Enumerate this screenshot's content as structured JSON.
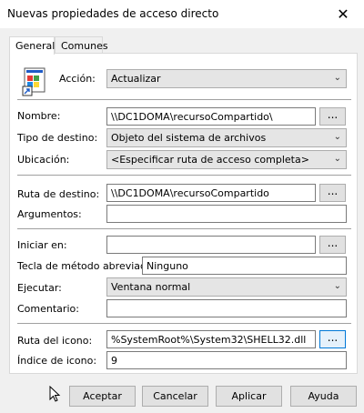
{
  "window": {
    "title": "Nuevas propiedades de acceso directo",
    "close_glyph": "✕"
  },
  "tabs": [
    {
      "label": "General",
      "active": true
    },
    {
      "label": "Comunes",
      "active": false
    }
  ],
  "general": {
    "accion_label": "Acción:",
    "accion_value": "Actualizar",
    "nombre_label": "Nombre:",
    "nombre_value": "\\\\DC1DOMA\\recursoCompartido\\",
    "tipo_label": "Tipo de destino:",
    "tipo_value": "Objeto del sistema de archivos",
    "ubicacion_label": "Ubicación:",
    "ubicacion_value": "<Especificar ruta de acceso completa>",
    "ruta_label": "Ruta de destino:",
    "ruta_value": "\\\\DC1DOMA\\recursoCompartido",
    "argumentos_label": "Argumentos:",
    "argumentos_value": "",
    "iniciar_label": "Iniciar en:",
    "iniciar_value": "",
    "tecla_label": "Tecla de método abreviado:",
    "tecla_value": "Ninguno",
    "ejecutar_label": "Ejecutar:",
    "ejecutar_value": "Ventana normal",
    "comentario_label": "Comentario:",
    "comentario_value": "",
    "icono_label": "Ruta del icono:",
    "icono_value": "%SystemRoot%\\System32\\SHELL32.dll",
    "indice_label": "Índice de icono:",
    "indice_value": "9",
    "browse_label": "..."
  },
  "buttons": {
    "accept": "Aceptar",
    "cancel": "Cancelar",
    "apply": "Aplicar",
    "help": "Ayuda"
  },
  "icons": {
    "app": "shortcut-app-icon",
    "chevron": "chevron-down-icon",
    "cursor": "mouse-cursor-icon"
  }
}
